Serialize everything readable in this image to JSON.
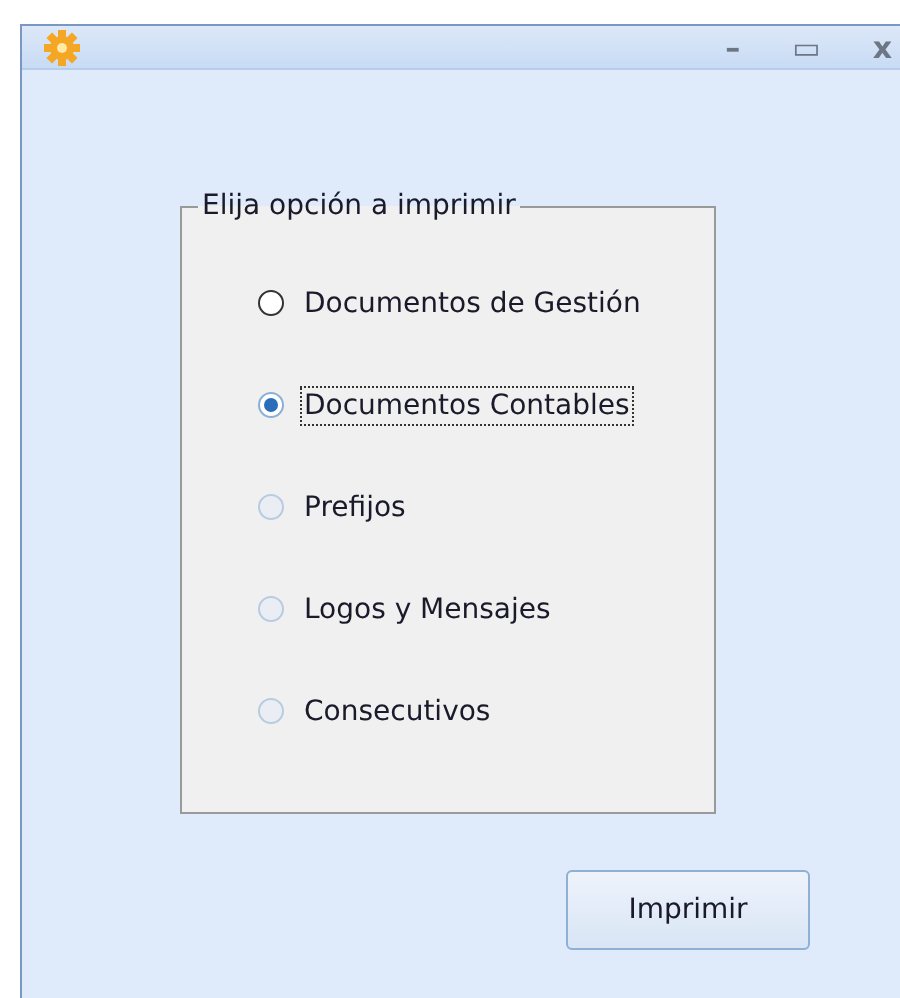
{
  "window": {
    "controls": [
      "–",
      "▭",
      "x"
    ]
  },
  "group": {
    "title": "Elija opción a imprimir",
    "options": [
      {
        "label": "Documentos de Gestión",
        "selected": false,
        "disabled": false
      },
      {
        "label": "Documentos Contables",
        "selected": true,
        "disabled": false
      },
      {
        "label": "Prefijos",
        "selected": false,
        "disabled": true
      },
      {
        "label": "Logos y Mensajes",
        "selected": false,
        "disabled": true
      },
      {
        "label": "Consecutivos",
        "selected": false,
        "disabled": true
      }
    ]
  },
  "buttons": [
    {
      "label": "Imprimir"
    }
  ]
}
